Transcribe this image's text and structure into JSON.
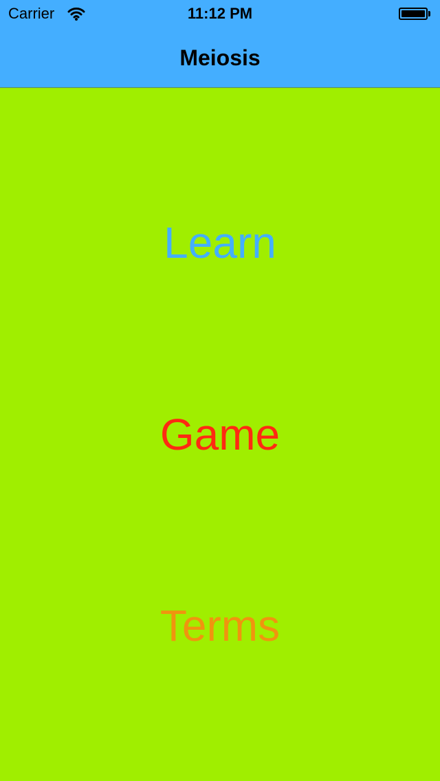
{
  "status_bar": {
    "carrier": "Carrier",
    "time": "11:12 PM",
    "wifi_icon": "wifi-icon",
    "battery_icon": "battery-full-icon"
  },
  "nav": {
    "title": "Meiosis"
  },
  "menu": {
    "learn": {
      "label": "Learn",
      "color": "#44aeff"
    },
    "game": {
      "label": "Game",
      "color": "#ff2a12"
    },
    "terms": {
      "label": "Terms",
      "color": "#f0940f"
    }
  },
  "colors": {
    "background": "#a0ee00",
    "nav_background": "#44aeff"
  }
}
